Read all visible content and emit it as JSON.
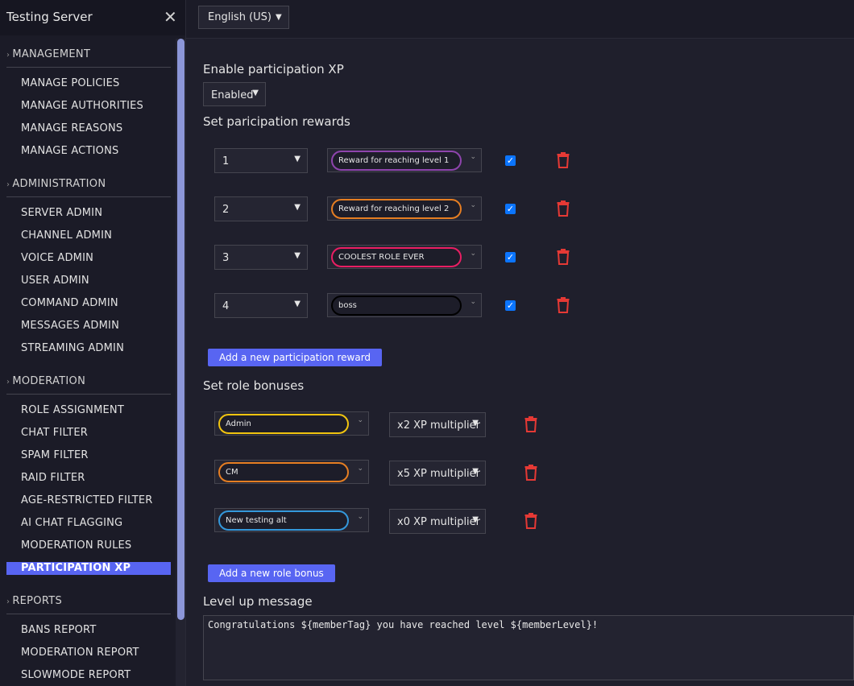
{
  "sidebar": {
    "title": "Testing Server",
    "close_glyph": "✕",
    "sections": [
      {
        "label": "MANAGEMENT",
        "items": [
          "MANAGE POLICIES",
          "MANAGE AUTHORITIES",
          "MANAGE REASONS",
          "MANAGE ACTIONS"
        ]
      },
      {
        "label": "ADMINISTRATION",
        "items": [
          "SERVER ADMIN",
          "CHANNEL ADMIN",
          "VOICE ADMIN",
          "USER ADMIN",
          "COMMAND ADMIN",
          "MESSAGES ADMIN",
          "STREAMING ADMIN"
        ]
      },
      {
        "label": "MODERATION",
        "items": [
          "ROLE ASSIGNMENT",
          "CHAT FILTER",
          "SPAM FILTER",
          "RAID FILTER",
          "AGE-RESTRICTED FILTER",
          "AI CHAT FLAGGING",
          "MODERATION RULES",
          "PARTICIPATION XP"
        ]
      },
      {
        "label": "REPORTS",
        "items": [
          "BANS REPORT",
          "MODERATION REPORT",
          "SLOWMODE REPORT"
        ]
      }
    ],
    "active_item": "PARTICIPATION XP"
  },
  "topbar": {
    "language": "English (US)"
  },
  "main": {
    "enable_heading": "Enable participation XP",
    "enable_value": "Enabled",
    "rewards_heading": "Set paricipation rewards",
    "rewards": [
      {
        "level": "1",
        "role": "Reward for reaching level 1",
        "color": "#8e44ad",
        "checked": true
      },
      {
        "level": "2",
        "role": "Reward for reaching level 2",
        "color": "#e67e22",
        "checked": true
      },
      {
        "level": "3",
        "role": "COOLEST ROLE EVER",
        "color": "#e91e63",
        "checked": true
      },
      {
        "level": "4",
        "role": "boss",
        "color": "#000000",
        "checked": true
      }
    ],
    "add_reward_label": "Add a new participation reward",
    "bonuses_heading": "Set role bonuses",
    "bonuses": [
      {
        "role": "Admin",
        "color": "#f1c40f",
        "multiplier": "x2 XP multiplier"
      },
      {
        "role": "CM",
        "color": "#e67e22",
        "multiplier": "x5 XP multiplier"
      },
      {
        "role": "New testing alt",
        "color": "#3498db",
        "multiplier": "x0 XP multiplier"
      }
    ],
    "add_bonus_label": "Add a new role bonus",
    "levelup_heading": "Level up message",
    "levelup_message": "Congratulations ${memberTag} you have reached level ${memberLevel}!"
  },
  "colors": {
    "accent": "#5865f2",
    "delete": "#e53935",
    "checkbox": "#0b75ff"
  }
}
